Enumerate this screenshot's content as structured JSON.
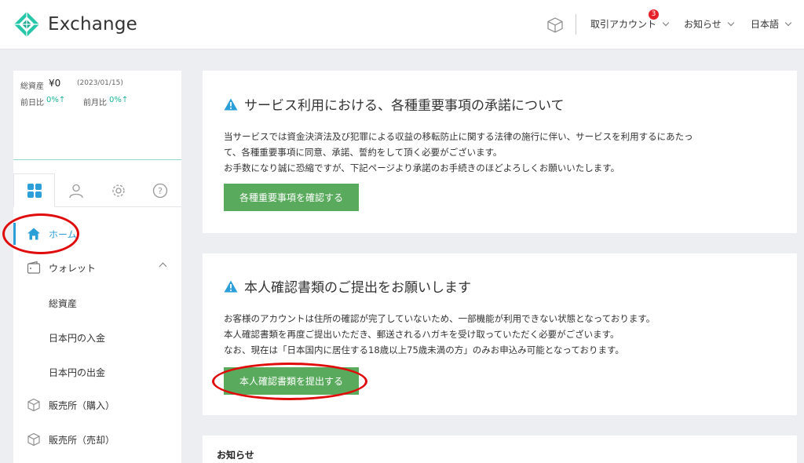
{
  "header": {
    "brand": "Exchange",
    "account_menu": "取引アカウント",
    "account_badge": "3",
    "notices_menu": "お知らせ",
    "language_menu": "日本語",
    "icons": {
      "logo": "diamond-logo-icon",
      "cube": "cube-icon",
      "chevron": "chevron-down-icon"
    }
  },
  "summary": {
    "total_label": "総資産",
    "total_value": "¥0",
    "date": "(2023/01/15)",
    "prev_day_label": "前日比",
    "prev_day_value": "0%↑",
    "prev_month_label": "前月比",
    "prev_month_value": "0%↑"
  },
  "sidebar": {
    "tabs": [
      "dashboard-grid-icon",
      "user-icon",
      "gear-icon",
      "help-icon"
    ],
    "items": [
      {
        "label": "ホーム",
        "icon": "home-icon"
      },
      {
        "label": "ウォレット",
        "icon": "wallet-icon"
      },
      {
        "label": "総資産"
      },
      {
        "label": "日本円の入金"
      },
      {
        "label": "日本円の出金"
      },
      {
        "label": "販売所（購入）",
        "icon": "cube-icon"
      },
      {
        "label": "販売所（売却）",
        "icon": "cube-icon"
      }
    ]
  },
  "cards": [
    {
      "title": "サービス利用における、各種重要事項の承諾について",
      "lines": [
        "当サービスでは資金決済法及び犯罪による収益の移転防止に関する法律の施行に伴い、サービスを利用するにあたっ",
        "て、各種重要事項に同意、承諾、誓約をして頂く必要がございます。",
        "お手数になり誠に恐縮ですが、下記ページより承諾のお手続きのほどよろしくお願いいたします。"
      ],
      "button": "各種重要事項を確認する"
    },
    {
      "title": "本人確認書類のご提出をお願いします",
      "lines": [
        "お客様のアカウントは住所の確認が完了していないため、一部機能が利用できない状態となっております。",
        "本人確認書類を再度ご提出いただき、郵送されるハガキを受け取っていただく必要がございます。",
        "なお、現在は「日本国内に居住する18歳以上75歳未満の方」のみお申込み可能となっております。"
      ],
      "button": "本人確認書類を提出する"
    }
  ],
  "notice": {
    "title": "お知らせ"
  },
  "colors": {
    "accent": "#2c9ed8",
    "button": "#5aaa5d",
    "badge": "#e5212a",
    "annotation": "#e00b0b",
    "gain": "#1bb69a"
  }
}
